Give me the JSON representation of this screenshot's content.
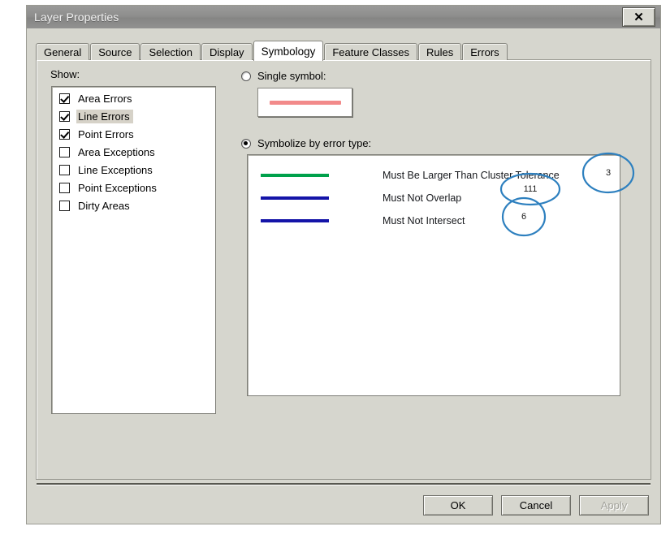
{
  "window": {
    "title": "Layer Properties",
    "close_label": "✕"
  },
  "tabs": [
    {
      "label": "General",
      "active": false
    },
    {
      "label": "Source",
      "active": false
    },
    {
      "label": "Selection",
      "active": false
    },
    {
      "label": "Display",
      "active": false
    },
    {
      "label": "Symbology",
      "active": true
    },
    {
      "label": "Feature Classes",
      "active": false
    },
    {
      "label": "Rules",
      "active": false
    },
    {
      "label": "Errors",
      "active": false
    }
  ],
  "show": {
    "label": "Show:",
    "items": [
      {
        "label": "Area Errors",
        "checked": true,
        "selected": false
      },
      {
        "label": "Line Errors",
        "checked": true,
        "selected": true
      },
      {
        "label": "Point Errors",
        "checked": true,
        "selected": false
      },
      {
        "label": "Area Exceptions",
        "checked": false,
        "selected": false
      },
      {
        "label": "Line Exceptions",
        "checked": false,
        "selected": false
      },
      {
        "label": "Point Exceptions",
        "checked": false,
        "selected": false
      },
      {
        "label": "Dirty Areas",
        "checked": false,
        "selected": false
      }
    ]
  },
  "symbology": {
    "single_symbol": {
      "label": "Single symbol:",
      "selected": false,
      "swatch_color": "#f28a8a"
    },
    "by_error_type": {
      "label": "Symbolize by error type:",
      "selected": true,
      "rules": [
        {
          "label": "Must Be Larger Than Cluster Tolerance",
          "color": "#00a14b",
          "count": "3"
        },
        {
          "label": "Must Not Overlap",
          "color": "#1414a8",
          "count": "111"
        },
        {
          "label": "Must Not Intersect",
          "color": "#1414a8",
          "count": "6"
        }
      ]
    }
  },
  "annotation": {
    "ring_color": "#2e80bf"
  },
  "footer": {
    "ok": "OK",
    "cancel": "Cancel",
    "apply": "Apply"
  }
}
